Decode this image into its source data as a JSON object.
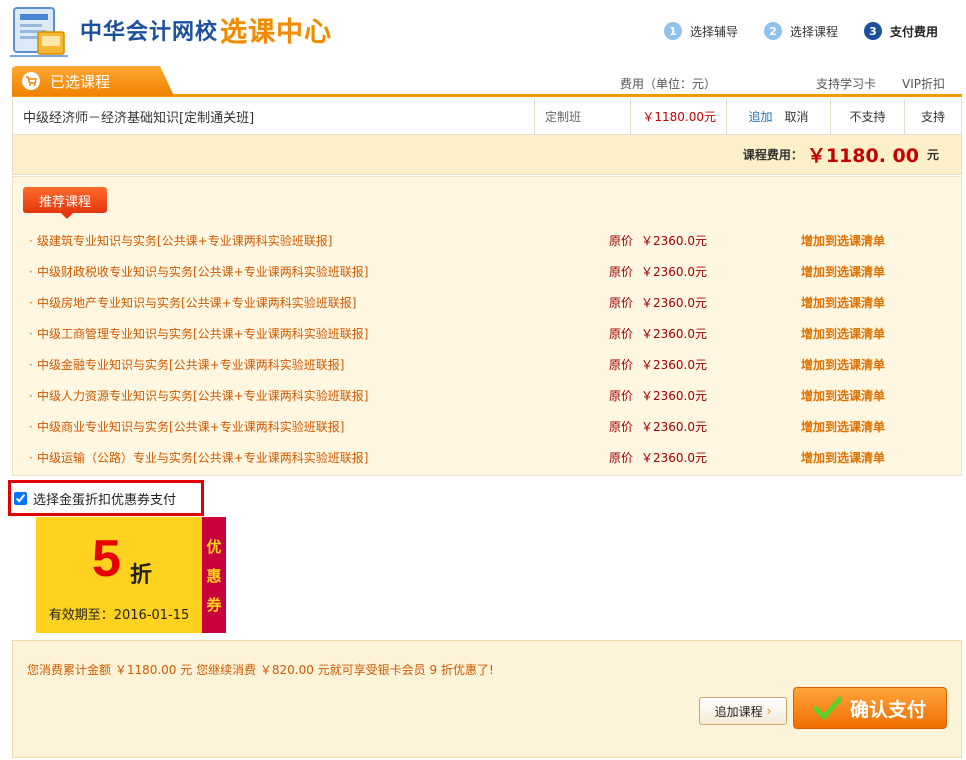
{
  "header": {
    "logo_text": "中华会计网校",
    "logo_sub": "选课中心",
    "steps": [
      {
        "num": "1",
        "label": "选择辅导"
      },
      {
        "num": "2",
        "label": "选择课程"
      },
      {
        "num": "3",
        "label": "支付费用"
      }
    ]
  },
  "tabs": {
    "selected_label": "已选课程",
    "col_fee": "费用（单位：元）",
    "col_card": "支持学习卡",
    "col_vip": "VIP折扣"
  },
  "selected_course": {
    "name": "中级经济师－经济基础知识[定制通关班]",
    "type": "定制班",
    "price": "￥1180.00元",
    "add_label": "追加",
    "cancel_label": "取消",
    "card": "不支持",
    "vip": "支持"
  },
  "fee": {
    "label": "课程费用：",
    "value": "￥1180. 00",
    "unit": "元"
  },
  "recommend": {
    "badge": "推荐课程",
    "price_label": "原价",
    "add_label": "增加到选课清单",
    "items": [
      {
        "name": "级建筑专业知识与实务[公共课+专业课两科实验班联报]",
        "price": "￥2360.0元"
      },
      {
        "name": "中级财政税收专业知识与实务[公共课+专业课两科实验班联报]",
        "price": "￥2360.0元"
      },
      {
        "name": "中级房地产专业知识与实务[公共课+专业课两科实验班联报]",
        "price": "￥2360.0元"
      },
      {
        "name": "中级工商管理专业知识与实务[公共课+专业课两科实验班联报]",
        "price": "￥2360.0元"
      },
      {
        "name": "中级金融专业知识与实务[公共课+专业课两科实验班联报]",
        "price": "￥2360.0元"
      },
      {
        "name": "中级人力资源专业知识与实务[公共课+专业课两科实验班联报]",
        "price": "￥2360.0元"
      },
      {
        "name": "中级商业专业知识与实务[公共课+专业课两科实验班联报]",
        "price": "￥2360.0元"
      },
      {
        "name": "中级运输（公路）专业与实务[公共课+专业课两科实验班联报]",
        "price": "￥2360.0元"
      }
    ]
  },
  "coupon": {
    "checkbox_label": "选择金蛋折扣优惠券支付",
    "checked": true,
    "discount_num": "5",
    "discount_unit": "折",
    "expire": "有效期至：2016-01-15",
    "side_chars": [
      "优",
      "惠",
      "券"
    ]
  },
  "bottom": {
    "summary": "您消费累计金额 ￥1180.00 元 您继续消费 ￥820.00 元就可享受银卡会员 9 折优惠了!",
    "add_course_label": "追加课程",
    "pay_label": "确认支付"
  },
  "colors": {
    "brand_orange": "#f39800",
    "brand_blue": "#1c4f9c",
    "price_red": "#c40000",
    "coupon_yellow": "#ffd21f",
    "coupon_red": "#c8003c"
  }
}
